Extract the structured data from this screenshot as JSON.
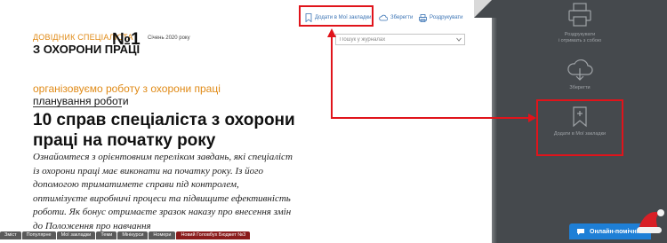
{
  "logo": {
    "line1": "ДОВІДНИК СПЕЦІАЛІСТА",
    "line2": "З ОХОРОНИ ПРАЦІ",
    "number": "№1",
    "issue_date": "Січень 2020 року"
  },
  "top_actions": {
    "bookmark": "Додати в Мої закладки",
    "save": "Зберегти",
    "print": "Роздрукувати"
  },
  "search": {
    "placeholder": "Пошук у журналах"
  },
  "article": {
    "category": "організовуємо роботу з охорони праці",
    "subcategory": "планування роботи",
    "title": "10 справ спеціаліста з охорони праці на початку року",
    "lead": "Ознайомтеся з орієнтовним переліком завдань, які спеціаліст із охорони праці має виконати на початку року. Із його допомогою триматимете справи під контролем, оптимізуєте виробничі процеси та підвищите ефективність роботи. Як бонус отримаєте зразок наказу про внесення змін до Положення про навчання"
  },
  "bottom_tabs": [
    "Зміст",
    "Популярне",
    "Мої закладки",
    "Теми",
    "Мінікурси",
    "Номери",
    "Новий Головбух Бюджет №3"
  ],
  "side_panel": {
    "print_label_1": "Роздрукувати",
    "print_label_2": "і отримать з собою",
    "save_label": "Зберегти",
    "bookmark_label": "Додати в Мої закладки"
  },
  "helper": {
    "label": "Онлайн-помічник"
  },
  "colors": {
    "accent_orange": "#e08a16",
    "highlight_red": "#e0141b",
    "link_blue": "#3a73b4",
    "panel_dark": "#45494d",
    "helper_blue": "#1e7fd6"
  }
}
